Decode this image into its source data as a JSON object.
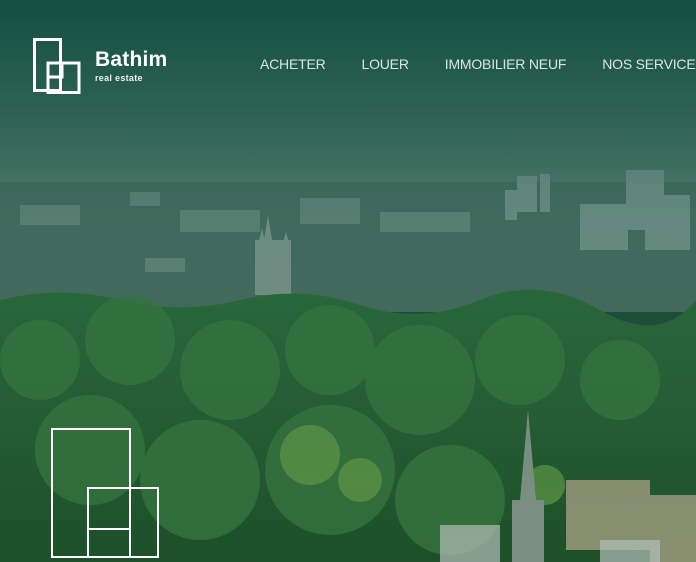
{
  "brand": {
    "name": "Bathim",
    "tagline": "real estate"
  },
  "nav": {
    "items": [
      {
        "label": "ACHETER"
      },
      {
        "label": "LOUER"
      },
      {
        "label": "IMMOBILIER NEUF"
      },
      {
        "label": "NOS SERVICES"
      }
    ]
  },
  "colors": {
    "overlay": "#0e483a",
    "logo_stroke": "#ffffff",
    "nav_text": "#d9e6df"
  },
  "hero": {
    "icon": "bathim-logo-mark-large"
  }
}
